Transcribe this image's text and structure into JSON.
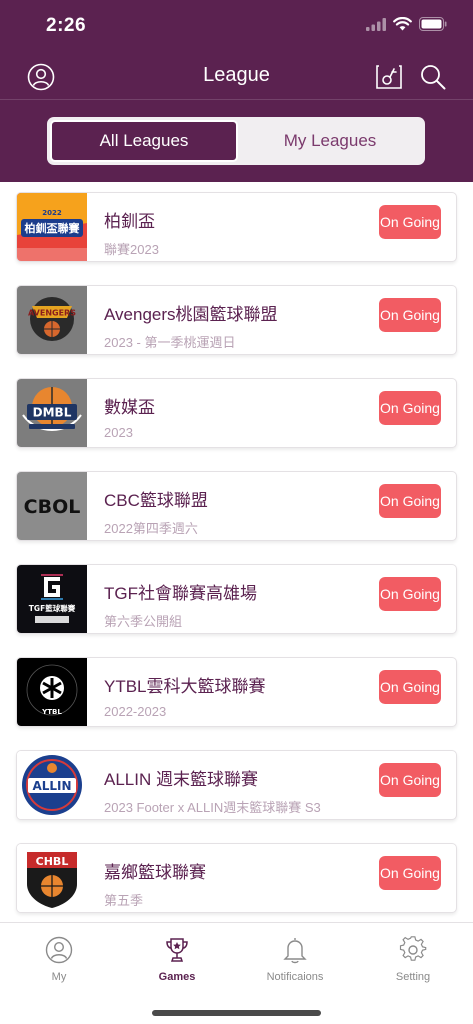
{
  "status_bar": {
    "time": "2:26"
  },
  "nav": {
    "title": "League"
  },
  "segments": {
    "all_label": "All Leagues",
    "my_label": "My Leagues",
    "selected": "All Leagues"
  },
  "colors": {
    "brand": "#5b2250",
    "badge": "#f25c63",
    "subtitle": "#b9a3b5"
  },
  "leagues": [
    {
      "title": "柏釧盃",
      "subtitle": "聯賽2023",
      "status": "On Going",
      "logo_text": "柏釧盃聯賽"
    },
    {
      "title": "Avengers桃園籃球聯盟",
      "subtitle": "2023 - 第一季桃運週日",
      "status": "On Going",
      "logo_text": "AVENGERS"
    },
    {
      "title": "數媒盃",
      "subtitle": "2023",
      "status": "On Going",
      "logo_text": "DMBL"
    },
    {
      "title": "CBC籃球聯盟",
      "subtitle": "2022第四季週六",
      "status": "On Going",
      "logo_text": "CBOL"
    },
    {
      "title": "TGF社會聯賽高雄場",
      "subtitle": "第六季公開組",
      "status": "On Going",
      "logo_text": "TGF籃球聯賽"
    },
    {
      "title": "YTBL雲科大籃球聯賽",
      "subtitle": "2022-2023",
      "status": "On Going",
      "logo_text": "YTBL"
    },
    {
      "title": "ALLIN 週末籃球聯賽",
      "subtitle": "2023 Footer x ALLIN週末籃球聯賽 S3",
      "status": "On Going",
      "logo_text": "ALLIN"
    },
    {
      "title": "嘉鄉籃球聯賽",
      "subtitle": "第五季",
      "status": "On Going",
      "logo_text": "CHBL"
    }
  ],
  "tabs": [
    {
      "label": "My",
      "icon": "person-icon"
    },
    {
      "label": "Games",
      "icon": "trophy-icon"
    },
    {
      "label": "Notificaions",
      "icon": "bell-icon"
    },
    {
      "label": "Setting",
      "icon": "gear-icon"
    }
  ]
}
